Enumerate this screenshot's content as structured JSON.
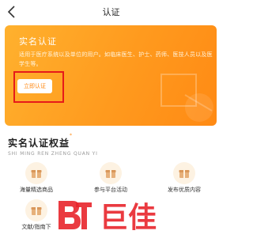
{
  "navbar": {
    "title": "认证",
    "back_icon": "chevron-left-icon"
  },
  "banner": {
    "title": "实名认证",
    "description": "适用于医疗系统以及单位的用户。如临床医生、护士、药师、医技人员以及医学生等。",
    "button_label": "立即认证",
    "gradient_colors": [
      "#ffb12e",
      "#ff8a14"
    ]
  },
  "section": {
    "title": "实名认证权益",
    "star": "*",
    "subtitle": "SHI MING REN ZHENG QUAN YI"
  },
  "benefits": [
    {
      "label": "海量精选商品",
      "icon": "gift-box-icon"
    },
    {
      "label": "参与平台活动",
      "icon": "gift-box-icon"
    },
    {
      "label": "发布优质内容",
      "icon": "gift-box-icon"
    },
    {
      "label": "文献/指南下",
      "icon": "gift-box-icon"
    }
  ],
  "watermark": {
    "text": "巨佳",
    "icon": "logo-mark",
    "color": "#e8252b"
  },
  "accent_color": "#ff8a14"
}
